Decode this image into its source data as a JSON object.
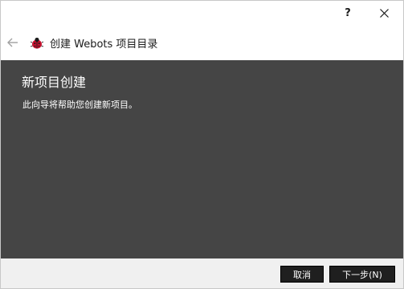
{
  "titlebar": {
    "help_label": "?",
    "close_icon": "close-icon"
  },
  "navbar": {
    "back_icon": "back-arrow-icon",
    "app_icon": "webots-ladybug-icon",
    "title": "创建 Webots 项目目录"
  },
  "page": {
    "heading": "新项目创建",
    "description": "此向导将帮助您创建新项目。"
  },
  "footer": {
    "cancel_label": "取消",
    "next_label": "下一步(N)"
  },
  "colors": {
    "content_bg": "#454545",
    "button_bg": "#1f1f1f",
    "footer_bg": "#f0f0f0",
    "icon_red": "#c8102e"
  }
}
